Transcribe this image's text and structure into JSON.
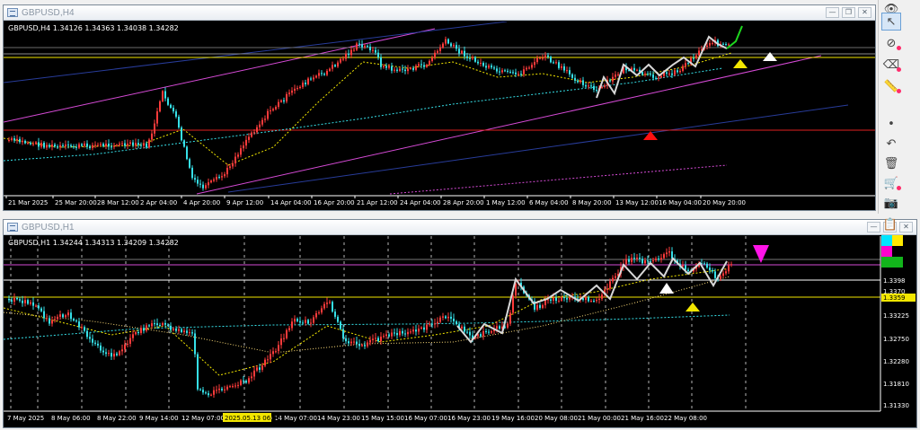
{
  "windows": {
    "h4": {
      "title": "GBPUSD,H4",
      "info": "GBPUSD,H4  1.34126 1.34363 1.34038 1.34282",
      "x_labels": [
        "21 Mar 2025",
        "25 Mar 20:00",
        "28 Mar 12:00",
        "2 Apr 04:00",
        "4 Apr 20:00",
        "9 Apr 12:00",
        "14 Apr 04:00",
        "16 Apr 20:00",
        "21 Apr 12:00",
        "24 Apr 04:00",
        "28 Apr 20:00",
        "1 May 12:00",
        "6 May 04:00",
        "8 May 20:00",
        "13 May 12:00",
        "16 May 04:00",
        "20 May 20:00"
      ]
    },
    "h1": {
      "title": "GBPUSD,H1",
      "info": "GBPUSD,H1  1.34244 1.34313 1.34209 1.34282",
      "x_labels": [
        "7 May 2025",
        "8 May 06:00",
        "8 May 22:00",
        "9 May 14:00",
        "12 May 07:00",
        "13 May 15:00",
        "14 May 07:00",
        "14 May 23:00",
        "15 May 15:00",
        "16 May 07:00",
        "16 May 23:00",
        "19 May 16:00",
        "20 May 08:00",
        "21 May 00:00",
        "21 May 16:00",
        "22 May 08:00"
      ],
      "highlight_time": "2025.05.13 06:00",
      "y_labels": [
        "1.3398",
        "1.3370",
        "1.3359",
        "1.33225",
        "1.32750",
        "1.32280",
        "1.31810",
        "1.31330"
      ]
    },
    "controls": {
      "minimize": "—",
      "restore": "❐",
      "close": "✕"
    }
  },
  "colors": {
    "bull": "#ff3b3b",
    "bear": "#36e0e8",
    "red_line": "#e02020",
    "yellow": "#f2e600",
    "magenta": "#d54ad5",
    "navy": "#283c9a",
    "white": "#ffffff",
    "green": "#1fd61f"
  },
  "toolbar": [
    {
      "name": "eye-icon",
      "glyph": "👁"
    },
    {
      "name": "cursor-icon",
      "glyph": "↖"
    },
    {
      "name": "pen-off-icon",
      "glyph": "⊘"
    },
    {
      "name": "eraser-icon",
      "glyph": "⌫"
    },
    {
      "name": "ruler-icon",
      "glyph": "📏"
    },
    {
      "name": "dot-icon",
      "glyph": "•"
    },
    {
      "name": "undo-icon",
      "glyph": "↶"
    },
    {
      "name": "trash-icon",
      "glyph": "🗑"
    },
    {
      "name": "cart-icon",
      "glyph": "🛒"
    },
    {
      "name": "camera-icon",
      "glyph": "📷"
    },
    {
      "name": "clipboard-icon",
      "glyph": "📋"
    }
  ],
  "palette": [
    "#00e5ff",
    "#ffea00",
    "#ff00cc",
    "#000000",
    "#12b41b",
    "#12b41b"
  ]
}
